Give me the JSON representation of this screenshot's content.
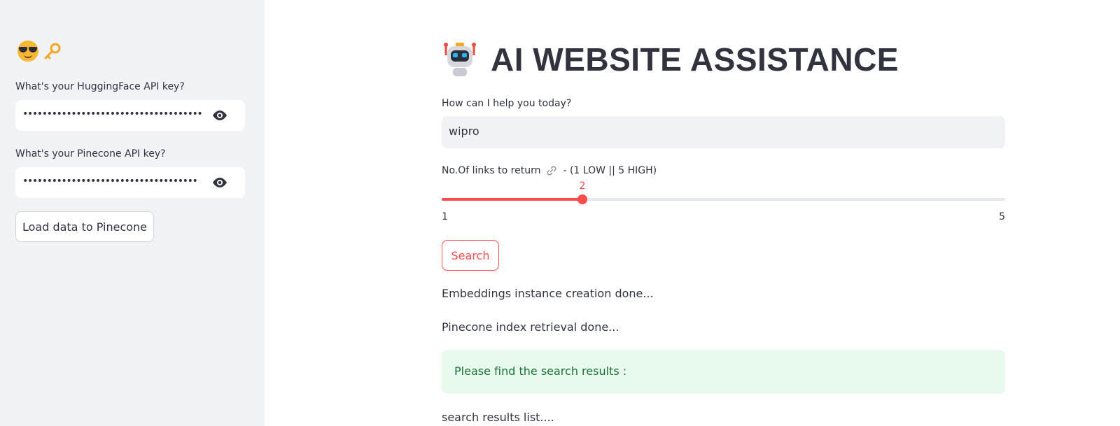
{
  "sidebar": {
    "emoji_icons": [
      "sunglasses-face-icon",
      "key-icon"
    ],
    "huggingface_label": "What's your HuggingFace API key?",
    "huggingface_value": "•••••••••••••••••••••••••••••••••••••",
    "pinecone_label": "What's your Pinecone API key?",
    "pinecone_value": "••••••••••••••••••••••••••••••••••••",
    "load_button": "Load data to Pinecone"
  },
  "main": {
    "title": "AI WEBSITE ASSISTANCE",
    "title_icon": "robot-icon",
    "query_label": "How can I help you today?",
    "query_value": "wipro",
    "slider": {
      "label_prefix": "No.Of links to return",
      "label_suffix": "- (1 LOW || 5 HIGH)",
      "value": "2",
      "min": "1",
      "max": "5",
      "fraction": 0.25
    },
    "search_button": "Search",
    "status_1": "Embeddings instance creation done...",
    "status_2": "Pinecone index retrieval done...",
    "success_message": "Please find the search results :",
    "results_text": "search results list...."
  },
  "colors": {
    "accent": "#ff4b4b",
    "sidebar_bg": "#f0f2f6",
    "success_bg": "#e8f9ee",
    "success_text": "#177233",
    "text": "#31333f"
  }
}
